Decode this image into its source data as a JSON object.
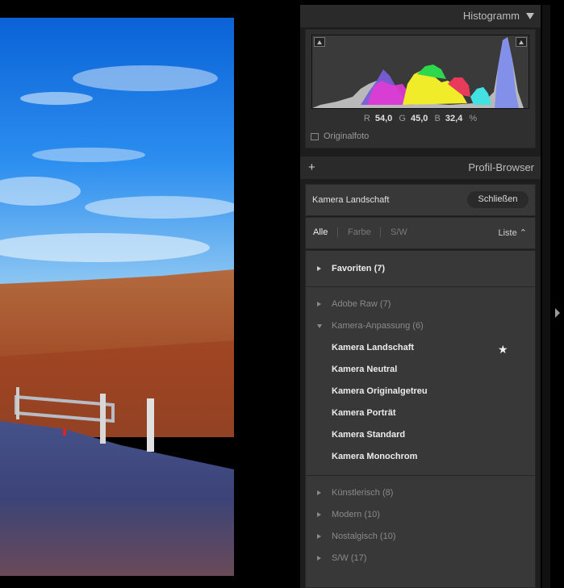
{
  "histogram": {
    "title": "Histogramm",
    "readout": {
      "r_label": "R",
      "r_value": "54,0",
      "g_label": "G",
      "g_value": "45,0",
      "b_label": "B",
      "b_value": "32,4",
      "unit": "%"
    },
    "original_label": "Originalfoto"
  },
  "profile_browser": {
    "title": "Profil-Browser",
    "current_profile": "Kamera Landschaft",
    "close_label": "Schließen",
    "filters": [
      "Alle",
      "Farbe",
      "S/W"
    ],
    "view_select": "Liste ⌃",
    "favorites": "Favoriten (7)",
    "groups_top": [
      "Adobe Raw (7)"
    ],
    "open_group": "Kamera-Anpassung (6)",
    "profiles": [
      "Kamera Landschaft",
      "Kamera Neutral",
      "Kamera Originalgetreu",
      "Kamera Porträt",
      "Kamera Standard",
      "Kamera Monochrom"
    ],
    "groups_bottom": [
      "Künstlerisch (8)",
      "Modern (10)",
      "Nostalgisch (10)",
      "S/W (17)"
    ]
  },
  "icons": {
    "star": "star-icon",
    "add": "plus-icon",
    "panel_collapse": "triangle-down-icon"
  }
}
